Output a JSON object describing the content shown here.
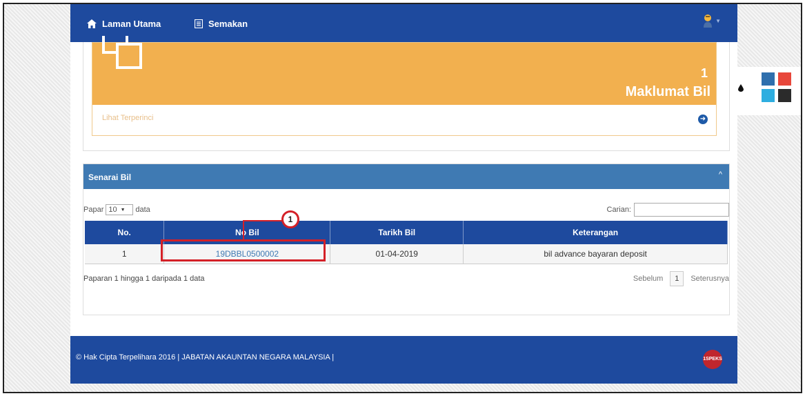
{
  "nav": {
    "home_label": "Laman Utama",
    "review_label": "Semakan"
  },
  "stat": {
    "number": "1",
    "label": "Maklumat Bil",
    "detail_link": "Lihat Terperinci"
  },
  "panel": {
    "title": "Senarai Bil",
    "length_prefix": "Papar",
    "length_value": "10",
    "length_suffix": "data",
    "search_label": "Carian:",
    "search_value": ""
  },
  "table": {
    "headers": [
      "No.",
      "No Bil",
      "Tarikh Bil",
      "Keterangan"
    ],
    "rows": [
      [
        "1",
        "19DBBL0500002",
        "01-04-2019",
        "bil advance bayaran deposit"
      ]
    ]
  },
  "pagination": {
    "info": "Paparan 1 hingga 1 daripada 1 data",
    "prev_label": "Sebelum",
    "page": "1",
    "next_label": "Seterusnya"
  },
  "annotation": {
    "badge": "1"
  },
  "footer": {
    "text": "© Hak Cipta Terpelihara 2016 | JABATAN AKAUNTAN NEGARA MALAYSIA |",
    "logo_text": "1SPEKS"
  },
  "theme": {
    "swatches": [
      "#2f6fad",
      "#e8473b",
      "#2eaee0",
      "#2b2b2b"
    ]
  },
  "colors": {
    "primary": "#1e4a9e",
    "panel_header": "#3f7ab3",
    "stat_tile": "#f2b04f",
    "annotation": "#d42027"
  }
}
